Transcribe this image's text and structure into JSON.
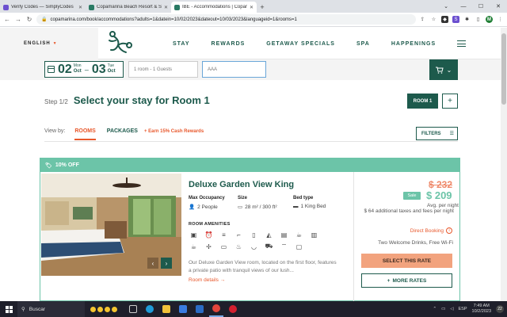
{
  "browser": {
    "tabs": [
      {
        "title": "Verify Codes — SimplyCodes",
        "color": "#6b4fcf",
        "active": false
      },
      {
        "title": "Copamarina Beach Resort & Spa",
        "color": "#2a7a64",
        "active": false
      },
      {
        "title": "IBE - Accommodations | Copam",
        "color": "#2a7a64",
        "active": true
      }
    ],
    "new_tab": "+",
    "window_controls": {
      "minimize": "—",
      "maximize": "☐",
      "close": "✕"
    },
    "url": "copamarina.com/book/accommodations?adults=1&datein=10/02/2023&dateout=10/03/2023&languageid=1&rooms=1"
  },
  "header": {
    "language": "ENGLISH",
    "nav": [
      "STAY",
      "REWARDS",
      "GETAWAY SPECIALS",
      "SPA",
      "HAPPENINGS"
    ]
  },
  "booking": {
    "checkin": {
      "day": "02",
      "weekday": "Mon",
      "month": "Oct"
    },
    "checkout": {
      "day": "03",
      "weekday": "Tue",
      "month": "Oct"
    },
    "dash": "–",
    "guests": "1 room - 1 Guests",
    "promo": "AAA"
  },
  "step": {
    "number": "Step 1/2",
    "title": "Select your stay for Room 1",
    "room_button": "ROOM 1",
    "add_button": "+"
  },
  "view_by": {
    "label": "View by:",
    "rooms": "ROOMS",
    "packages": "PACKAGES",
    "earn": "+ Earn 15% Cash Rewards",
    "filters": "FILTERS"
  },
  "room": {
    "badge": "10% OFF",
    "title": "Deluxe Garden View King",
    "occupancy_label": "Max Occupancy",
    "occupancy_value": "2 People",
    "size_label": "Size",
    "size_value": "28 m² / 300 ft²",
    "bed_label": "Bed type",
    "bed_value": "1 King Bed",
    "amenities_label": "ROOM AMENITIES",
    "amenity_icons_row1": [
      "microwave-icon",
      "alarm-clock-icon",
      "towels-icon",
      "hair-dryer-icon",
      "bottle-icon",
      "iron-icon",
      "safe-icon",
      "kettle-icon",
      "closet-icon"
    ],
    "amenity_icons_row2": [
      "coffee-icon",
      "fan-icon",
      "tv-icon",
      "shower-icon",
      "bathtub-icon",
      "car-icon",
      "wifi-icon",
      "lock-icon"
    ],
    "description": "Our Deluxe Garden View room, located on the first floor, features a private patio with tranquil views of our lush...",
    "details_link": "Room details →",
    "prev": "‹",
    "next": "›"
  },
  "price": {
    "old": "$ 232",
    "sale_badge": "Sale",
    "new": "$ 209",
    "avg_label": "Avg. per night",
    "taxes": "$ 64 additional taxes and fees per night",
    "direct": "Direct Booking",
    "perk": "Two Welcome Drinks, Free Wi-Fi",
    "select": "SELECT THIS RATE",
    "more": "MORE RATES"
  },
  "taskbar": {
    "search": "Buscar",
    "language": "ESP",
    "time": "7:49 AM",
    "date": "10/2/2023",
    "notifications": "22"
  }
}
